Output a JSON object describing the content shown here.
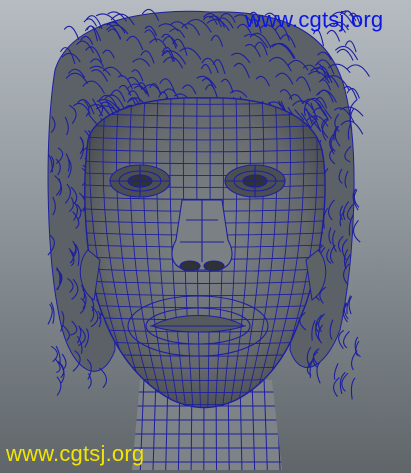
{
  "viewport": {
    "background_top": "#b6bcc2",
    "background_bottom": "#5f6569",
    "wireframe_color": "#1d1fa0",
    "mesh_fill": "#6f7375",
    "mesh_shadow": "#3e4244"
  },
  "watermarks": {
    "top": {
      "text": "www.cgtsj.org",
      "color": "#0b17e6"
    },
    "bottom": {
      "text": "www.cgtsj.org",
      "color": "#f2e600"
    }
  },
  "subject": {
    "icon": "polygon-mesh-head-icon"
  }
}
